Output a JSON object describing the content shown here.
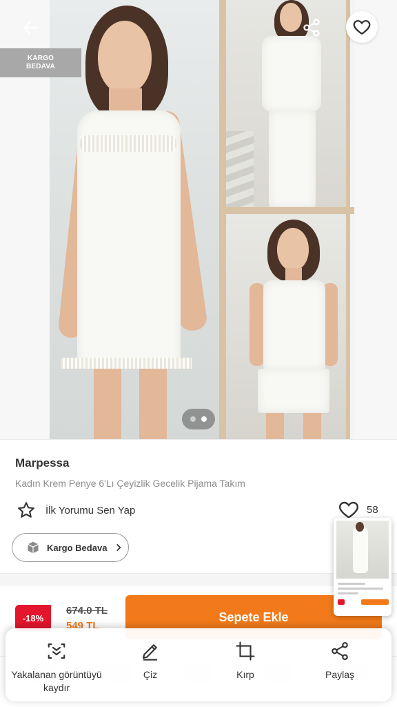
{
  "header": {
    "back_icon": "arrow-left-icon",
    "share_icon": "share-icon",
    "favorite_icon": "heart-outline-icon"
  },
  "ribbon": {
    "line1": "KARGO",
    "line2": "BEDAVA"
  },
  "gallery": {
    "page_count": 2,
    "active_page": 2
  },
  "product": {
    "brand": "Marpessa",
    "title": "Kadın Krem Penye 6'Lı Çeyizlik Gecelik Pijama Takım",
    "review_cta": "İlk Yorumu Sen Yap",
    "like_count": "58",
    "shipping_chip": "Kargo Bedava"
  },
  "pricing": {
    "discount": "-18%",
    "old_price": "674.0 TL",
    "new_price": "549 TL",
    "add_to_cart": "Sepete Ekle"
  },
  "screenshot_sheet": {
    "actions": [
      {
        "label": "Yakalanan görüntüyü kaydır",
        "icon": "scroll-capture-icon"
      },
      {
        "label": "Çiz",
        "icon": "pencil-icon"
      },
      {
        "label": "Kırp",
        "icon": "crop-icon"
      },
      {
        "label": "Paylaş",
        "icon": "share-icon"
      }
    ]
  },
  "colors": {
    "accent": "#f27a1a",
    "discount": "#e3162d",
    "ribbon": "#a8a8a8"
  }
}
